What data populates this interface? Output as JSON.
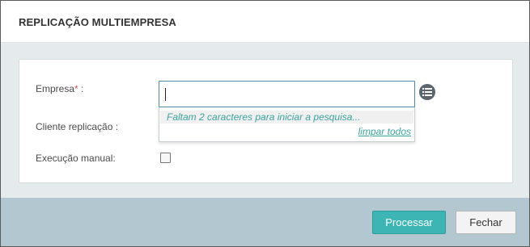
{
  "dialog": {
    "title": "REPLICAÇÃO MULTIEMPRESA"
  },
  "form": {
    "empresa": {
      "label": "Empresa",
      "required_mark": "*",
      "label_suffix": " :",
      "value": "",
      "placeholder": ""
    },
    "cliente_replicacao": {
      "label": "Cliente replicação :"
    },
    "execucao_manual": {
      "label": "Execução manual:",
      "checked": false
    },
    "dropdown": {
      "message": "Faltam 2 caracteres para iniciar a pesquisa...",
      "clear_link": "limpar todos"
    }
  },
  "footer": {
    "process_label": "Processar",
    "close_label": "Fechar"
  },
  "colors": {
    "primary": "#3db5b5",
    "footer_bg": "#b3c7d1",
    "link": "#3aa39e",
    "required": "#d9534f"
  },
  "icons": {
    "list_button": "list-icon"
  }
}
